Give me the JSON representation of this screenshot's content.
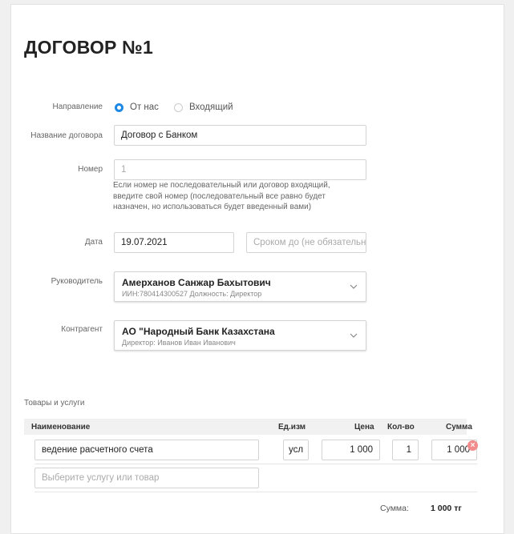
{
  "title": "ДОГОВОР №1",
  "direction": {
    "label": "Направление",
    "options": [
      "От нас",
      "Входящий"
    ],
    "selected_index": 0
  },
  "name": {
    "label": "Название договора",
    "value": "Договор с Банком"
  },
  "number": {
    "label": "Номер",
    "placeholder": "1",
    "hint": "Если номер не последовательный или договор входящий, введите свой номер (последовательный все равно будет назначен, но использоваться будет введенный вами)"
  },
  "date": {
    "label": "Дата",
    "value": "19.07.2021",
    "until_placeholder": "Сроком до (не обязательно"
  },
  "manager": {
    "label": "Руководитель",
    "name": "Амерханов Санжар Бахытович",
    "details": "ИИН:780414300527 Должность: Директор"
  },
  "counterparty": {
    "label": "Контрагент",
    "name": "АО \"Народный Банк Казахстана",
    "details": "Директор: Иванов Иван Иванович"
  },
  "goods": {
    "section_label": "Товары и услуги",
    "columns": {
      "name": "Наименование",
      "unit": "Ед.изм",
      "price": "Цена",
      "qty": "Кол-во",
      "sum": "Сумма"
    },
    "rows": [
      {
        "name": "ведение расчетного счета",
        "unit": "усл",
        "price": "1 000",
        "qty": "1",
        "sum": "1 000"
      }
    ],
    "new_item_placeholder": "Выберите услугу или товар",
    "total_label": "Сумма:",
    "total_value": "1 000 тг"
  }
}
